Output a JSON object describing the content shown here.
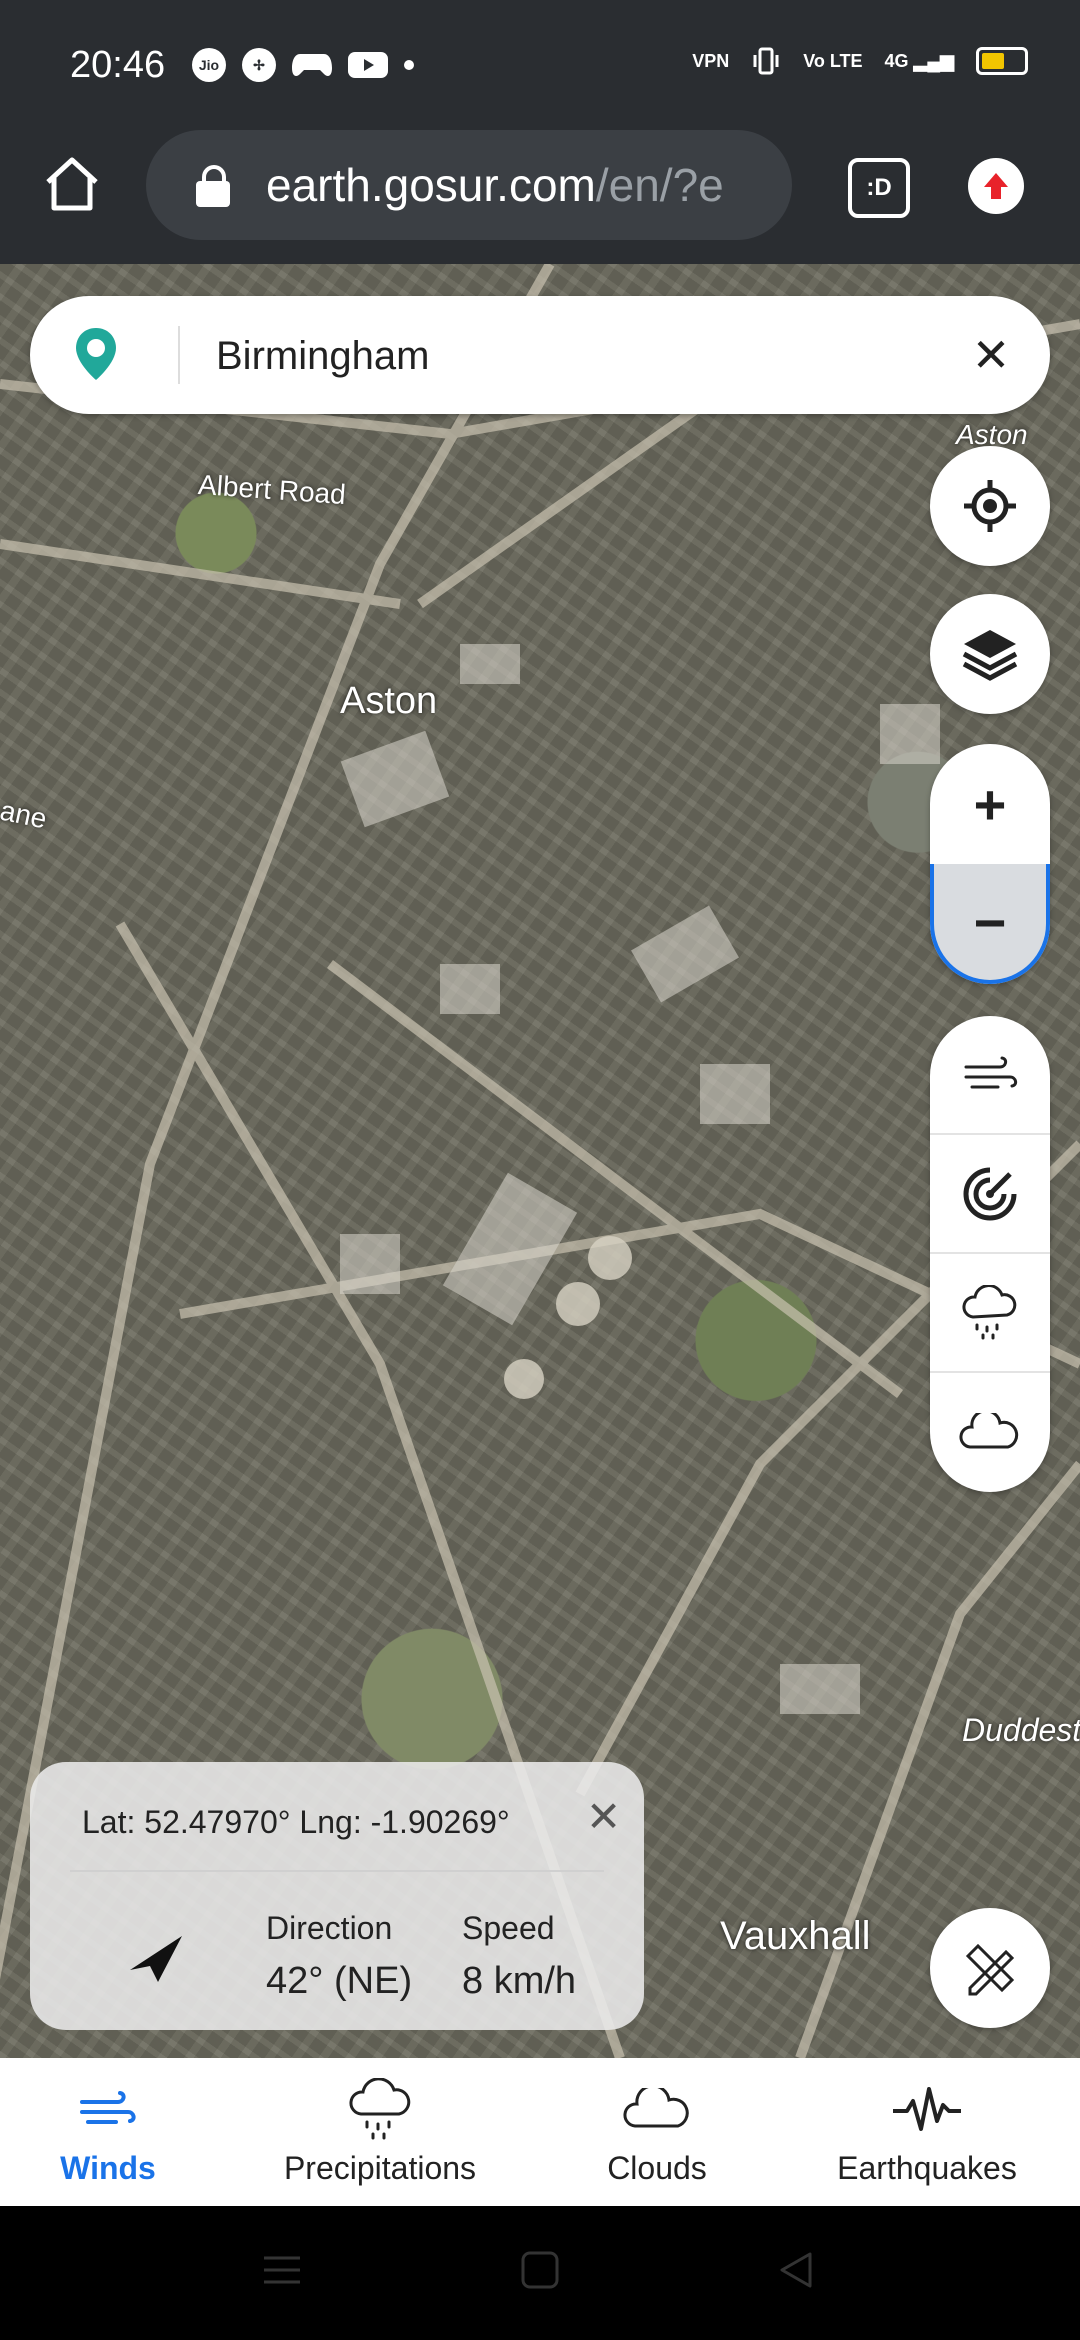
{
  "status_bar": {
    "time": "20:46",
    "left_icons": [
      "jio-icon",
      "pinwheel-icon",
      "gamepad-icon",
      "youtube-icon",
      "dot-icon"
    ],
    "right_icons": [
      "vpn-icon",
      "vibrate-icon",
      "volte-icon",
      "signal-4g-icon",
      "battery-icon"
    ],
    "vpn_text": "VPN",
    "volte_text": "Vo LTE",
    "net_text": "4G"
  },
  "browser": {
    "url_host": "earth.gosur.com",
    "url_path": "/en/?e",
    "tab_switcher_label": ":D"
  },
  "search": {
    "value": "Birmingham",
    "clear_label": "✕"
  },
  "map": {
    "labels": [
      "Albert Road",
      "Aston",
      "Aston",
      "ane",
      "Duddest",
      "Vauxhall"
    ]
  },
  "info_card": {
    "coords": "Lat: 52.47970°  Lng: -1.90269°",
    "direction_label": "Direction",
    "direction_value": "42° (NE)",
    "speed_label": "Speed",
    "speed_value": "8 km/h",
    "close_label": "✕"
  },
  "zoom": {
    "plus": "+",
    "minus": "−"
  },
  "bottom_nav": [
    {
      "label": "Winds",
      "icon": "wind-icon",
      "active": true
    },
    {
      "label": "Precipitations",
      "icon": "rain-cloud-icon",
      "active": false
    },
    {
      "label": "Clouds",
      "icon": "cloud-icon",
      "active": false
    },
    {
      "label": "Earthquakes",
      "icon": "seismograph-icon",
      "active": false
    }
  ],
  "colors": {
    "accent": "#1a73e8",
    "pin": "#21a89a",
    "update": "#e8222a"
  }
}
